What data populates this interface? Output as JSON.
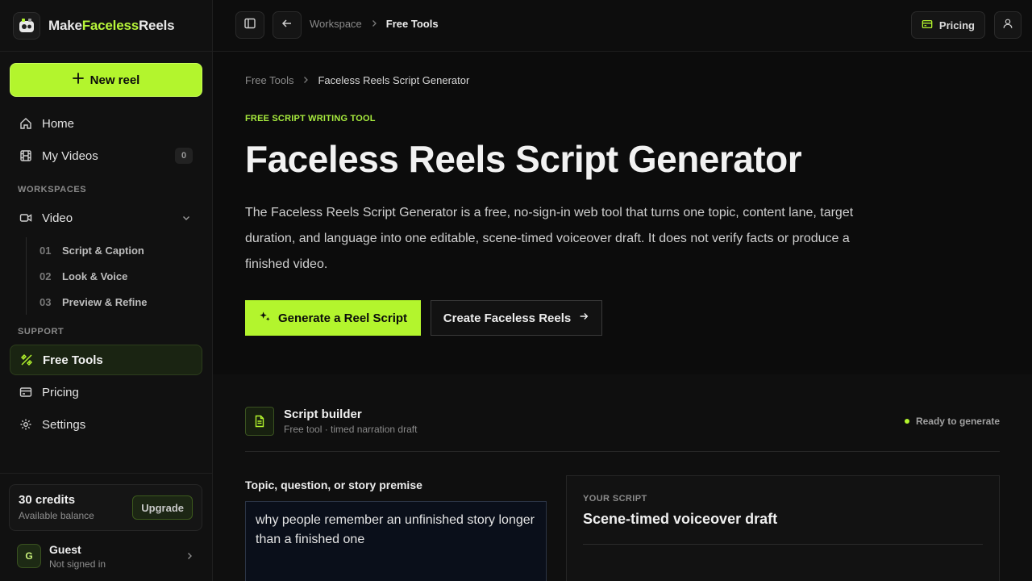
{
  "app": {
    "brand_part1": "Make",
    "brand_part2": "Faceless",
    "brand_part3": "Reels"
  },
  "sidebar": {
    "new_reel_label": "New reel",
    "home_label": "Home",
    "my_videos_label": "My Videos",
    "my_videos_count": "0",
    "workspaces_label": "WORKSPACES",
    "video_label": "Video",
    "steps": [
      {
        "num": "01",
        "label": "Script & Caption"
      },
      {
        "num": "02",
        "label": "Look & Voice"
      },
      {
        "num": "03",
        "label": "Preview & Refine"
      }
    ],
    "support_label": "SUPPORT",
    "free_tools_label": "Free Tools",
    "pricing_label": "Pricing",
    "settings_label": "Settings",
    "credits_title": "30 credits",
    "credits_sub": "Available balance",
    "upgrade_label": "Upgrade",
    "user_initial": "G",
    "user_name": "Guest",
    "user_status": "Not signed in"
  },
  "topbar": {
    "crumb_1": "Workspace",
    "crumb_2": "Free Tools",
    "pricing_label": "Pricing"
  },
  "main": {
    "breadcrumb_1": "Free Tools",
    "breadcrumb_2": "Faceless Reels Script Generator",
    "eyebrow": "FREE SCRIPT WRITING TOOL",
    "title": "Faceless Reels Script Generator",
    "description": "The Faceless Reels Script Generator is a free, no-sign-in web tool that turns one topic, content lane, target duration, and language into one editable, scene-timed voiceover draft. It does not verify facts or produce a finished video.",
    "cta_primary": "Generate a Reel Script",
    "cta_secondary": "Create Faceless Reels"
  },
  "builder": {
    "title": "Script builder",
    "subtitle": "Free tool · timed narration draft",
    "status": "Ready to generate",
    "topic_label": "Topic, question, or story premise",
    "topic_value": "why people remember an unfinished story longer than a finished one",
    "script_eyebrow": "YOUR SCRIPT",
    "script_title": "Scene-timed voiceover draft"
  },
  "colors": {
    "accent": "#b3f52d",
    "background": "#0c0c0c",
    "sidebar": "#111111"
  }
}
